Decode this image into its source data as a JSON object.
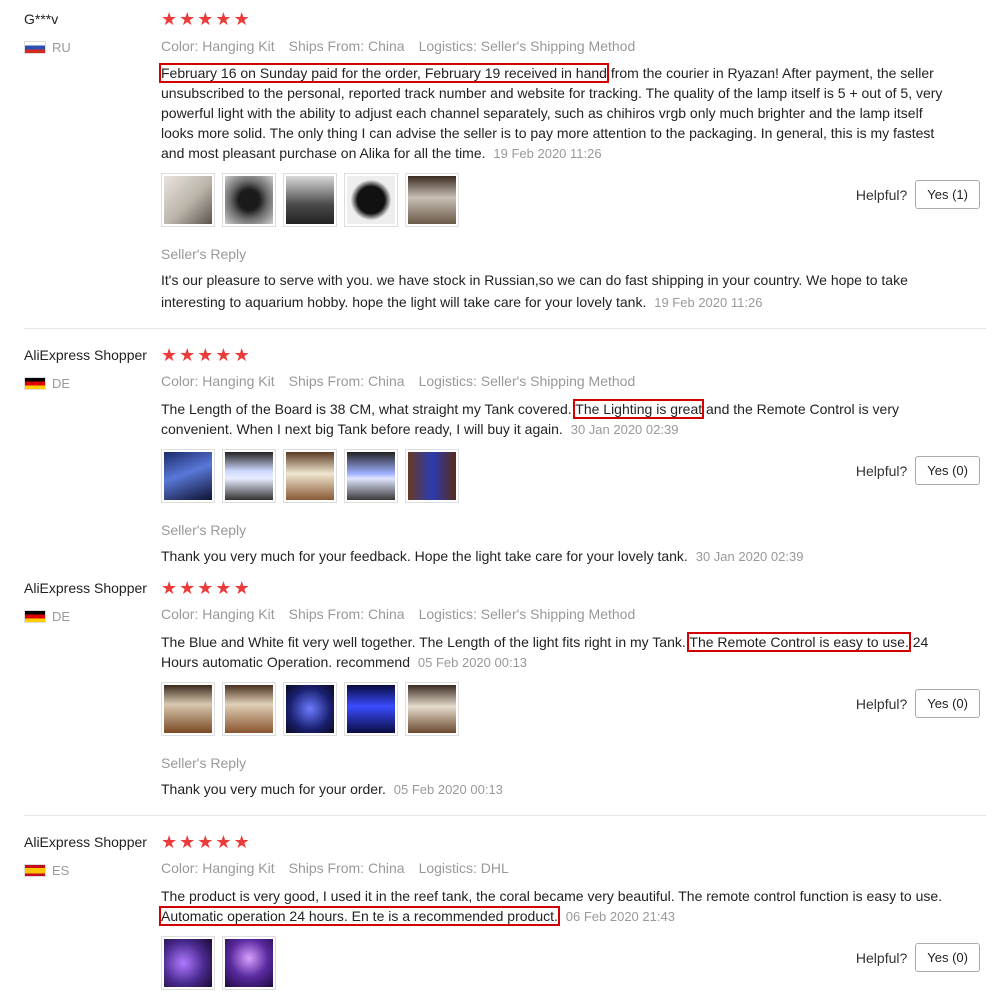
{
  "helpful_label": "Helpful?",
  "sellers_reply_label": "Seller's Reply",
  "star_char": "★",
  "reviews": [
    {
      "user": "G***v",
      "country": "RU",
      "color": "Color: Hanging Kit",
      "ships_from": "Ships From: China",
      "logistics": "Logistics: Seller's Shipping Method",
      "text_highlight": "February 16 on Sunday paid for the order, February 19 received in hand",
      "text_after": " from the courier in Ryazan! After payment, the seller unsubscribed to the personal, reported track number and website for tracking. The quality of the lamp itself is 5 + out of 5, very powerful light with the ability to adjust each channel separately, such as chihiros vrgb only much brighter and the lamp itself looks more solid. The only thing I can advise the seller is to pay more attention to the packaging. In general, this is my fastest and most pleasant purchase on Alika for all the time.",
      "date": "19 Feb 2020 11:26",
      "yes": "Yes (1)",
      "reply": "It's our pleasure to serve with you. we have stock in Russian,so we can do fast shipping in your country. We hope to take interesting to aquarium hobby. hope the light will take care for your lovely tank.",
      "reply_date": "19 Feb 2020 11:26"
    },
    {
      "user": "AliExpress Shopper",
      "country": "DE",
      "color": "Color: Hanging Kit",
      "ships_from": "Ships From: China",
      "logistics": "Logistics: Seller's Shipping Method",
      "text_before": "The Length of the Board is 38 CM, what straight my Tank covered. ",
      "text_highlight": "The Lighting is great",
      "text_after": " and the Remote Control is very convenient. When I next big Tank before ready, I will buy it again.",
      "date": "30 Jan 2020 02:39",
      "yes": "Yes (0)",
      "reply": "Thank you very much for your feedback. Hope the light take care for your lovely tank.",
      "reply_date": "30 Jan 2020 02:39"
    },
    {
      "user": "AliExpress Shopper",
      "country": "DE",
      "color": "Color: Hanging Kit",
      "ships_from": "Ships From: China",
      "logistics": "Logistics: Seller's Shipping Method",
      "text_before": "The Blue and White fit very well together. The Length of the light fits right in my Tank. ",
      "text_highlight": "The Remote Control is easy to use.",
      "text_after": " 24 Hours automatic Operation. recommend",
      "date": "05 Feb 2020 00:13",
      "yes": "Yes (0)",
      "reply": "Thank you very much for your order.",
      "reply_date": "05 Feb 2020 00:13"
    },
    {
      "user": "AliExpress Shopper",
      "country": "ES",
      "color": "Color: Hanging Kit",
      "ships_from": "Ships From: China",
      "logistics": "Logistics: DHL",
      "text_before": "The product is very good, I used it in the reef tank, the coral became very beautiful. The remote control function is easy to use. ",
      "text_highlight": "Automatic operation 24 hours. En te is a recommended product.",
      "date": "06 Feb 2020 21:43",
      "yes": "Yes (0)"
    }
  ],
  "colors": {
    "star": "#ec3b3b",
    "highlight_box": "#d40000",
    "muted_text": "#999999"
  }
}
